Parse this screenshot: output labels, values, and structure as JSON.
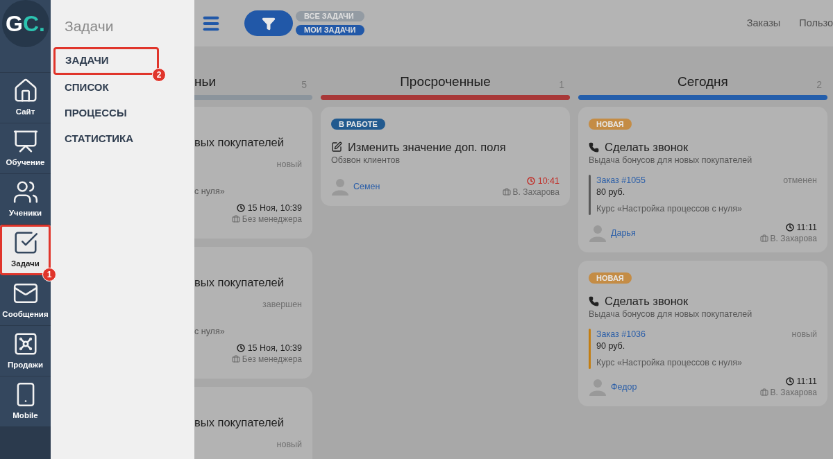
{
  "sidebar": {
    "logo": {
      "primary": "G",
      "accent": "C."
    },
    "items": [
      {
        "label": "Сайт",
        "selected": false
      },
      {
        "label": "Обучение",
        "selected": false
      },
      {
        "label": "Ученики",
        "selected": false
      },
      {
        "label": "Задачи",
        "selected": true,
        "callout": "1"
      },
      {
        "label": "Сообщения",
        "selected": false
      },
      {
        "label": "Продажи",
        "selected": false
      },
      {
        "label": "Mobile",
        "selected": false
      }
    ]
  },
  "flyout": {
    "title": "Задачи",
    "items": [
      {
        "label": "ЗАДАЧИ",
        "callout": "2"
      },
      {
        "label": "СПИСОК"
      },
      {
        "label": "ПРОЦЕССЫ"
      },
      {
        "label": "СТАТИСТИКА"
      }
    ]
  },
  "header": {
    "tabs": [
      {
        "label": "ВСЕ ЗАДАЧИ",
        "selected": false
      },
      {
        "label": "МОИ ЗАДАЧИ",
        "selected": true
      }
    ],
    "nav": [
      "Заказы",
      "Пользо"
    ]
  },
  "columns": [
    {
      "title": "ньи",
      "count": "5",
      "color": "#8b949c",
      "clipped": true,
      "cards": [
        {
          "title": "вых покупателей",
          "status": "новый",
          "course": "с нуля»",
          "time": "15 Ноя, 10:39",
          "time_overdue": false,
          "manager": "Без менеджера"
        },
        {
          "title": "вых покупателей",
          "status": "завершен",
          "course": "с нуля»",
          "time": "15 Ноя, 10:39",
          "time_overdue": false,
          "manager": "Без менеджера"
        },
        {
          "title": "вых покупателей",
          "status": "новый"
        }
      ]
    },
    {
      "title": "Просроченные",
      "count": "1",
      "color": "#a83838",
      "clipped": false,
      "cards": [
        {
          "badge": {
            "label": "В РАБОТЕ",
            "color": "#225a8f"
          },
          "kind": "edit",
          "title": "Изменить значение доп. поля",
          "subtitle": "Обзвон клиентов",
          "user": "Семен",
          "time": "10:41",
          "time_overdue": true,
          "manager": "В. Захарова"
        }
      ]
    },
    {
      "title": "Сегодня",
      "count": "2",
      "color": "#245eab",
      "clipped": false,
      "cards": [
        {
          "badge": {
            "label": "НОВАЯ",
            "color": "#c48c45"
          },
          "kind": "phone",
          "title": "Сделать звонок",
          "subtitle": "Выдача бонусов для новых покупателей",
          "order": {
            "link": "Заказ #1055",
            "price": "80 руб.",
            "color": "#5a5a5a"
          },
          "status": "отменен",
          "course": "Курс «Настройка процессов с нуля»",
          "user": "Дарья",
          "time": "11:11",
          "time_overdue": false,
          "manager": "В. Захарова"
        },
        {
          "badge": {
            "label": "НОВАЯ",
            "color": "#c48c45"
          },
          "kind": "phone",
          "title": "Сделать звонок",
          "subtitle": "Выдача бонусов для новых покупателей",
          "order": {
            "link": "Заказ #1036",
            "price": "90 руб.",
            "color": "#c27d12"
          },
          "status": "новый",
          "course": "Курс «Настройка процессов с нуля»",
          "user": "Федор",
          "time": "11:11",
          "time_overdue": false,
          "manager": "В. Захарова"
        }
      ]
    }
  ]
}
